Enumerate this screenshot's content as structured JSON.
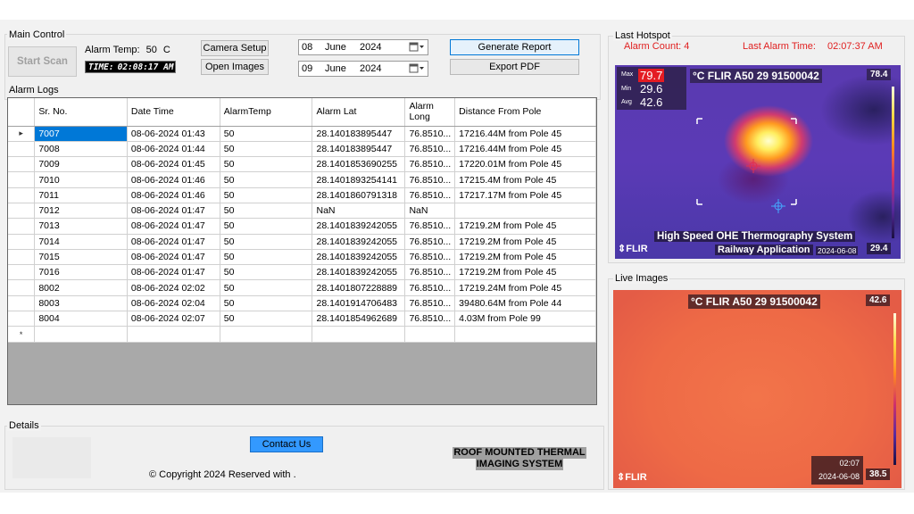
{
  "main_control": {
    "title": "Main Control",
    "start_scan_label": "Start Scan",
    "alarm_temp_label": "Alarm Temp:",
    "alarm_temp_value": "50",
    "alarm_temp_unit": "C",
    "time_label": "TIME:",
    "time_value": "02:08:17 AM",
    "camera_setup_label": "Camera Setup",
    "open_images_label": "Open Images",
    "from_date": {
      "day": "08",
      "month": "June",
      "year": "2024"
    },
    "to_date": {
      "day": "09",
      "month": "June",
      "year": "2024"
    },
    "generate_report_label": "Generate Report",
    "export_pdf_label": "Export PDF"
  },
  "alarm_logs": {
    "title": "Alarm Logs",
    "columns": [
      "Sr. No.",
      "Date Time",
      "AlarmTemp",
      "Alarm Lat",
      "Alarm Long",
      "Distance From Pole"
    ],
    "rows": [
      [
        "7007",
        "08-06-2024 01:43",
        "50",
        "28.140183895447",
        "76.8510...",
        "17216.44M from Pole 45"
      ],
      [
        "7008",
        "08-06-2024 01:44",
        "50",
        "28.140183895447",
        "76.8510...",
        "17216.44M from Pole 45"
      ],
      [
        "7009",
        "08-06-2024 01:45",
        "50",
        "28.1401853690255",
        "76.8510...",
        "17220.01M from Pole 45"
      ],
      [
        "7010",
        "08-06-2024 01:46",
        "50",
        "28.1401893254141",
        "76.8510...",
        "17215.4M from Pole 45"
      ],
      [
        "7011",
        "08-06-2024 01:46",
        "50",
        "28.1401860791318",
        "76.8510...",
        "17217.17M from Pole 45"
      ],
      [
        "7012",
        "08-06-2024 01:47",
        "50",
        "NaN",
        "NaN",
        ""
      ],
      [
        "7013",
        "08-06-2024 01:47",
        "50",
        "28.1401839242055",
        "76.8510...",
        "17219.2M from Pole 45"
      ],
      [
        "7014",
        "08-06-2024 01:47",
        "50",
        "28.1401839242055",
        "76.8510...",
        "17219.2M from Pole 45"
      ],
      [
        "7015",
        "08-06-2024 01:47",
        "50",
        "28.1401839242055",
        "76.8510...",
        "17219.2M from Pole 45"
      ],
      [
        "7016",
        "08-06-2024 01:47",
        "50",
        "28.1401839242055",
        "76.8510...",
        "17219.2M from Pole 45"
      ],
      [
        "8002",
        "08-06-2024 02:02",
        "50",
        "28.1401807228889",
        "76.8510...",
        "17219.24M from Pole 45"
      ],
      [
        "8003",
        "08-06-2024 02:04",
        "50",
        "28.1401914706483",
        "76.8510...",
        "39480.64M from Pole 44"
      ],
      [
        "8004",
        "08-06-2024 02:07",
        "50",
        "28.1401854962689",
        "76.8510...",
        "4.03M from Pole 99"
      ]
    ],
    "current_row_marker": "▸",
    "new_row_marker": "*"
  },
  "details": {
    "title": "Details",
    "contact_label": "Contact Us",
    "copyright": "© Copyright 2024 Reserved with .",
    "roof_line1": "ROOF MOUNTED THERMAL",
    "roof_line2": "IMAGING SYSTEM"
  },
  "last_hotspot": {
    "title": "Last Hotspot",
    "alarm_count_label": "Alarm Count:",
    "alarm_count_value": "4",
    "last_alarm_time_label": "Last Alarm Time:",
    "last_alarm_time_value": "02:07:37 AM",
    "max_label": "Max",
    "max_value": "79.7",
    "min_label": "Min",
    "min_value": "29.6",
    "avg_label": "Avg",
    "avg_value": "42.6",
    "camera_model": "°C FLIR A50 29 91500042",
    "scale_top": "78.4",
    "scale_bottom": "29.4",
    "overlay_line1": "High Speed OHE Thermography System",
    "overlay_line2": "Railway Application",
    "overlay_date": "2024-06-08",
    "brand": "FLIR"
  },
  "live_images": {
    "title": "Live Images",
    "camera_model": "°C FLIR A50 29 91500042",
    "scale_top": "42.6",
    "scale_bottom": "38.5",
    "time": "02:07",
    "date": "2024-06-08",
    "brand": "FLIR"
  },
  "colors": {
    "selection": "#0078d7",
    "alarm_red": "#e02020",
    "contact_blue": "#3399ff",
    "max_red": "#e41c23"
  }
}
